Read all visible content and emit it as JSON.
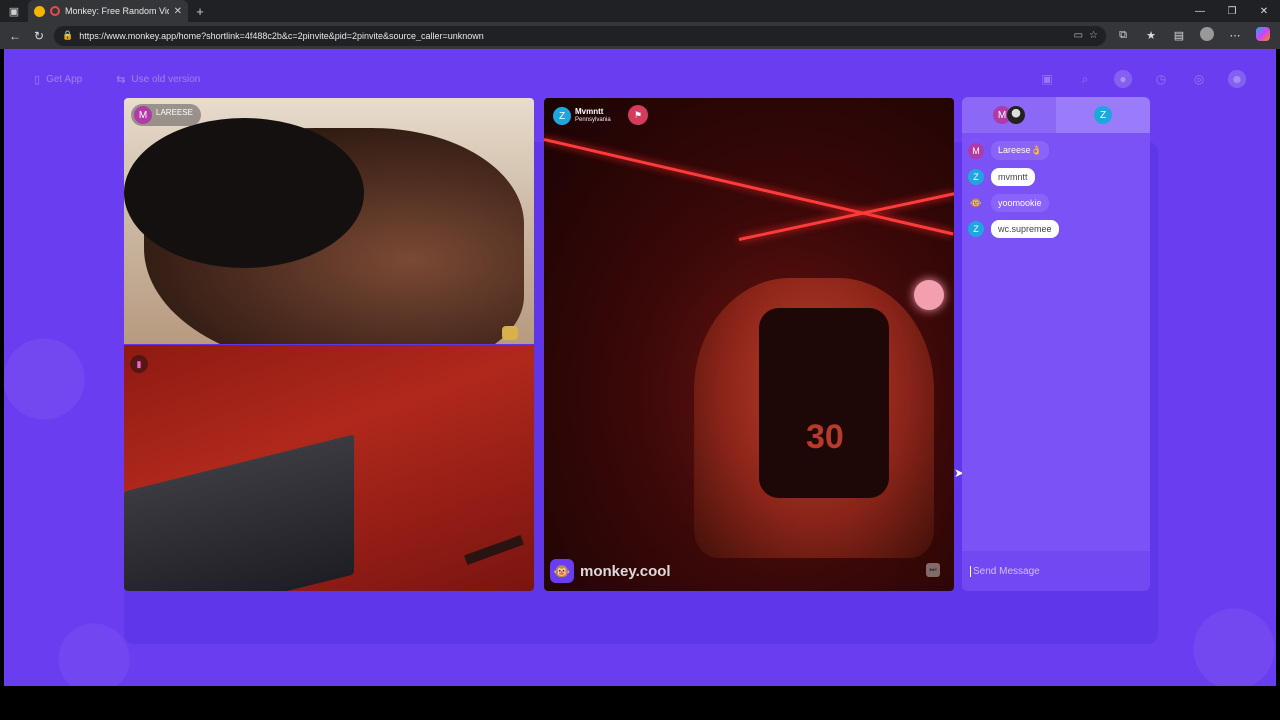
{
  "browser": {
    "tab_title": "Monkey: Free Random Video",
    "tab_close": "✕",
    "new_tab": "+",
    "url": "https://www.monkey.app/home?shortlink=4f488c2b&c=2pinvite&pid=2pinvite&source_caller=unknown",
    "window_controls": [
      "—",
      "❐",
      "✕"
    ]
  },
  "topnav": {
    "get_app": "Get App",
    "use_old_version": "Use old version"
  },
  "videos": {
    "top_left_user": "LAREESE",
    "top_left_initial": "M",
    "right_user": "Mvmntt",
    "right_location": "Pennsylvania",
    "right_initial": "Z",
    "jersey_number": "30",
    "watermark": "monkey.cool"
  },
  "chat": {
    "tab2_initial": "Z",
    "messages": [
      {
        "initial": "M",
        "text": "Lareese👌",
        "style": "purple"
      },
      {
        "initial": "Z",
        "text": "mvmntt",
        "style": "white"
      },
      {
        "initial": "🐵",
        "text": "yoomookie",
        "style": "purple"
      },
      {
        "initial": "Z",
        "text": "wc.supremee",
        "style": "white"
      }
    ],
    "input_placeholder": "Send Message"
  },
  "colors": {
    "page_bg": "#6a3df0",
    "chat_bg": "#7a52f5",
    "avatar_m": "#b23aa8",
    "avatar_z": "#1ca7e0"
  }
}
